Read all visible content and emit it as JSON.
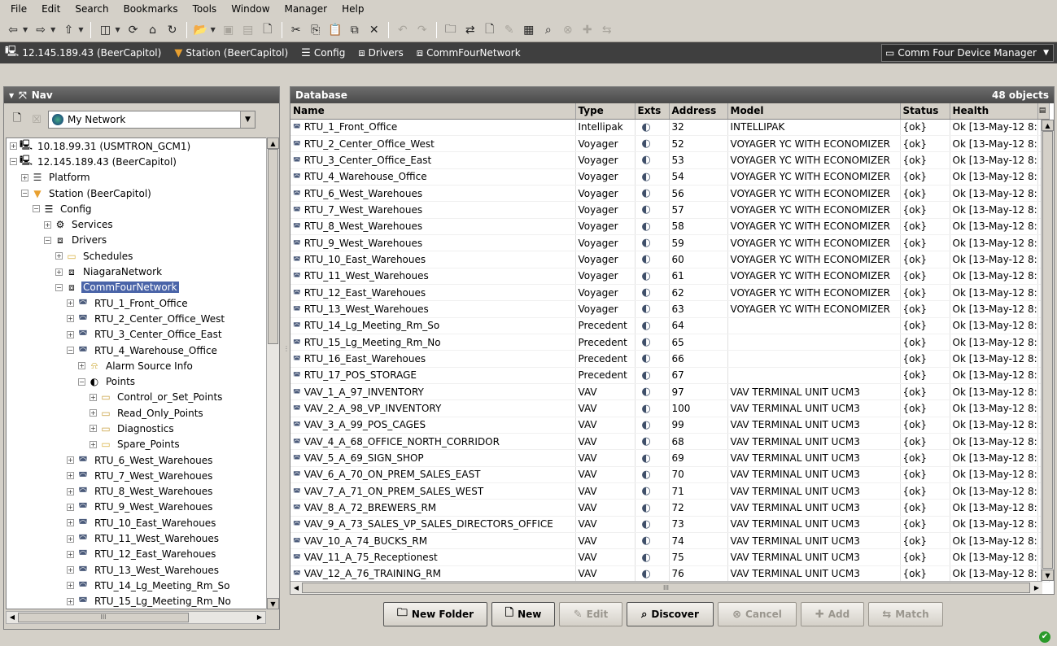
{
  "menu": [
    "File",
    "Edit",
    "Search",
    "Bookmarks",
    "Tools",
    "Window",
    "Manager",
    "Help"
  ],
  "locator": [
    {
      "label": "12.145.189.43 (BeerCapitol)",
      "icon": "host-icon"
    },
    {
      "label": "Station (BeerCapitol)",
      "icon": "station-icon"
    },
    {
      "label": "Config",
      "icon": "config-icon"
    },
    {
      "label": "Drivers",
      "icon": "drivers-icon"
    },
    {
      "label": "CommFourNetwork",
      "icon": "network-icon"
    }
  ],
  "view_selector": "Comm Four Device Manager",
  "nav": {
    "title": "Nav",
    "network_select": "My Network",
    "tree": [
      {
        "indent": 0,
        "expander": "+",
        "icon": "host-icon",
        "label": "10.18.99.31 (USMTRON_GCM1)"
      },
      {
        "indent": 0,
        "expander": "−",
        "icon": "host-icon",
        "label": "12.145.189.43 (BeerCapitol)"
      },
      {
        "indent": 1,
        "expander": "+",
        "icon": "platform-icon",
        "label": "Platform"
      },
      {
        "indent": 1,
        "expander": "−",
        "icon": "station-icon",
        "label": "Station (BeerCapitol)"
      },
      {
        "indent": 2,
        "expander": "−",
        "icon": "config-icon",
        "label": "Config"
      },
      {
        "indent": 3,
        "expander": "+",
        "icon": "services-icon",
        "label": "Services"
      },
      {
        "indent": 3,
        "expander": "−",
        "icon": "drivers-icon",
        "label": "Drivers"
      },
      {
        "indent": 4,
        "expander": "+",
        "icon": "folder-icon",
        "label": "Schedules"
      },
      {
        "indent": 4,
        "expander": "+",
        "icon": "network-icon",
        "label": "NiagaraNetwork"
      },
      {
        "indent": 4,
        "expander": "−",
        "icon": "network-icon",
        "label": "CommFourNetwork",
        "selected": true
      },
      {
        "indent": 5,
        "expander": "+",
        "icon": "device-icon",
        "label": "RTU_1_Front_Office"
      },
      {
        "indent": 5,
        "expander": "+",
        "icon": "device-icon",
        "label": "RTU_2_Center_Office_West"
      },
      {
        "indent": 5,
        "expander": "+",
        "icon": "device-icon",
        "label": "RTU_3_Center_Office_East"
      },
      {
        "indent": 5,
        "expander": "−",
        "icon": "device-icon",
        "label": "RTU_4_Warehouse_Office"
      },
      {
        "indent": 6,
        "expander": "+",
        "icon": "alarm-bell-icon",
        "label": "Alarm Source Info"
      },
      {
        "indent": 6,
        "expander": "−",
        "icon": "points-icon",
        "label": "Points"
      },
      {
        "indent": 7,
        "expander": "+",
        "icon": "points-folder-icon",
        "label": "Control_or_Set_Points"
      },
      {
        "indent": 7,
        "expander": "+",
        "icon": "points-folder-icon",
        "label": "Read_Only_Points"
      },
      {
        "indent": 7,
        "expander": "+",
        "icon": "points-folder-icon",
        "label": "Diagnostics"
      },
      {
        "indent": 7,
        "expander": "+",
        "icon": "folder-icon",
        "label": "Spare_Points"
      },
      {
        "indent": 5,
        "expander": "+",
        "icon": "device-icon",
        "label": "RTU_6_West_Warehoues"
      },
      {
        "indent": 5,
        "expander": "+",
        "icon": "device-icon",
        "label": "RTU_7_West_Warehoues"
      },
      {
        "indent": 5,
        "expander": "+",
        "icon": "device-icon",
        "label": "RTU_8_West_Warehoues"
      },
      {
        "indent": 5,
        "expander": "+",
        "icon": "device-icon",
        "label": "RTU_9_West_Warehoues"
      },
      {
        "indent": 5,
        "expander": "+",
        "icon": "device-icon",
        "label": "RTU_10_East_Warehoues"
      },
      {
        "indent": 5,
        "expander": "+",
        "icon": "device-icon",
        "label": "RTU_11_West_Warehoues"
      },
      {
        "indent": 5,
        "expander": "+",
        "icon": "device-icon",
        "label": "RTU_12_East_Warehoues"
      },
      {
        "indent": 5,
        "expander": "+",
        "icon": "device-icon",
        "label": "RTU_13_West_Warehoues"
      },
      {
        "indent": 5,
        "expander": "+",
        "icon": "device-icon",
        "label": "RTU_14_Lg_Meeting_Rm_So"
      },
      {
        "indent": 5,
        "expander": "+",
        "icon": "device-icon",
        "label": "RTU_15_Lg_Meeting_Rm_No"
      }
    ],
    "hscroll_marker": "III"
  },
  "database": {
    "title": "Database",
    "count": "48 objects",
    "columns": [
      "Name",
      "Type",
      "Exts",
      "Address",
      "Model",
      "Status",
      "Health"
    ],
    "rows": [
      [
        "RTU_1_Front_Office",
        "Intellipak",
        "32",
        "INTELLIPAK",
        "{ok}",
        "Ok [13-May-12 8:"
      ],
      [
        "RTU_2_Center_Office_West",
        "Voyager",
        "52",
        "VOYAGER YC WITH ECONOMIZER",
        "{ok}",
        "Ok [13-May-12 8:"
      ],
      [
        "RTU_3_Center_Office_East",
        "Voyager",
        "53",
        "VOYAGER YC WITH ECONOMIZER",
        "{ok}",
        "Ok [13-May-12 8:"
      ],
      [
        "RTU_4_Warehouse_Office",
        "Voyager",
        "54",
        "VOYAGER YC WITH ECONOMIZER",
        "{ok}",
        "Ok [13-May-12 8:"
      ],
      [
        "RTU_6_West_Warehoues",
        "Voyager",
        "56",
        "VOYAGER YC WITH ECONOMIZER",
        "{ok}",
        "Ok [13-May-12 8:"
      ],
      [
        "RTU_7_West_Warehoues",
        "Voyager",
        "57",
        "VOYAGER YC WITH ECONOMIZER",
        "{ok}",
        "Ok [13-May-12 8:"
      ],
      [
        "RTU_8_West_Warehoues",
        "Voyager",
        "58",
        "VOYAGER YC WITH ECONOMIZER",
        "{ok}",
        "Ok [13-May-12 8:"
      ],
      [
        "RTU_9_West_Warehoues",
        "Voyager",
        "59",
        "VOYAGER YC WITH ECONOMIZER",
        "{ok}",
        "Ok [13-May-12 8:"
      ],
      [
        "RTU_10_East_Warehoues",
        "Voyager",
        "60",
        "VOYAGER YC WITH ECONOMIZER",
        "{ok}",
        "Ok [13-May-12 8:"
      ],
      [
        "RTU_11_West_Warehoues",
        "Voyager",
        "61",
        "VOYAGER YC WITH ECONOMIZER",
        "{ok}",
        "Ok [13-May-12 8:"
      ],
      [
        "RTU_12_East_Warehoues",
        "Voyager",
        "62",
        "VOYAGER YC WITH ECONOMIZER",
        "{ok}",
        "Ok [13-May-12 8:"
      ],
      [
        "RTU_13_West_Warehoues",
        "Voyager",
        "63",
        "VOYAGER YC WITH ECONOMIZER",
        "{ok}",
        "Ok [13-May-12 8:"
      ],
      [
        "RTU_14_Lg_Meeting_Rm_So",
        "Precedent",
        "64",
        "",
        "{ok}",
        "Ok [13-May-12 8:"
      ],
      [
        "RTU_15_Lg_Meeting_Rm_No",
        "Precedent",
        "65",
        "",
        "{ok}",
        "Ok [13-May-12 8:"
      ],
      [
        "RTU_16_East_Warehoues",
        "Precedent",
        "66",
        "",
        "{ok}",
        "Ok [13-May-12 8:"
      ],
      [
        "RTU_17_POS_STORAGE",
        "Precedent",
        "67",
        "",
        "{ok}",
        "Ok [13-May-12 8:"
      ],
      [
        "VAV_1_A_97_INVENTORY",
        "VAV",
        "97",
        "VAV TERMINAL UNIT UCM3",
        "{ok}",
        "Ok [13-May-12 8:"
      ],
      [
        "VAV_2_A_98_VP_INVENTORY",
        "VAV",
        "100",
        "VAV TERMINAL UNIT UCM3",
        "{ok}",
        "Ok [13-May-12 8:"
      ],
      [
        "VAV_3_A_99_POS_CAGES",
        "VAV",
        "99",
        "VAV TERMINAL UNIT UCM3",
        "{ok}",
        "Ok [13-May-12 8:"
      ],
      [
        "VAV_4_A_68_OFFICE_NORTH_CORRIDOR",
        "VAV",
        "68",
        "VAV TERMINAL UNIT UCM3",
        "{ok}",
        "Ok [13-May-12 8:"
      ],
      [
        "VAV_5_A_69_SIGN_SHOP",
        "VAV",
        "69",
        "VAV TERMINAL UNIT UCM3",
        "{ok}",
        "Ok [13-May-12 8:"
      ],
      [
        "VAV_6_A_70_ON_PREM_SALES_EAST",
        "VAV",
        "70",
        "VAV TERMINAL UNIT UCM3",
        "{ok}",
        "Ok [13-May-12 8:"
      ],
      [
        "VAV_7_A_71_ON_PREM_SALES_WEST",
        "VAV",
        "71",
        "VAV TERMINAL UNIT UCM3",
        "{ok}",
        "Ok [13-May-12 8:"
      ],
      [
        "VAV_8_A_72_BREWERS_RM",
        "VAV",
        "72",
        "VAV TERMINAL UNIT UCM3",
        "{ok}",
        "Ok [13-May-12 8:"
      ],
      [
        "VAV_9_A_73_SALES_VP_SALES_DIRECTORS_OFFICE",
        "VAV",
        "73",
        "VAV TERMINAL UNIT UCM3",
        "{ok}",
        "Ok [13-May-12 8:"
      ],
      [
        "VAV_10_A_74_BUCKS_RM",
        "VAV",
        "74",
        "VAV TERMINAL UNIT UCM3",
        "{ok}",
        "Ok [13-May-12 8:"
      ],
      [
        "VAV_11_A_75_Receptionest",
        "VAV",
        "75",
        "VAV TERMINAL UNIT UCM3",
        "{ok}",
        "Ok [13-May-12 8:"
      ],
      [
        "VAV_12_A_76_TRAINING_RM",
        "VAV",
        "76",
        "VAV TERMINAL UNIT UCM3",
        "{ok}",
        "Ok [13-May-12 8:"
      ]
    ],
    "hscroll_marker": "III"
  },
  "buttons": [
    {
      "label": "New Folder",
      "icon": "new-folder-icon",
      "enabled": true
    },
    {
      "label": "New",
      "icon": "new-icon",
      "enabled": true
    },
    {
      "label": "Edit",
      "icon": "edit-icon",
      "enabled": false
    },
    {
      "label": "Discover",
      "icon": "binoculars-icon",
      "enabled": true
    },
    {
      "label": "Cancel",
      "icon": "cancel-icon",
      "enabled": false
    },
    {
      "label": "Add",
      "icon": "add-icon",
      "enabled": false
    },
    {
      "label": "Match",
      "icon": "match-icon",
      "enabled": false
    }
  ],
  "colors": {
    "chrome": "#d4d0c8",
    "locator_bar": "#3f3f3f",
    "selection": "#4a64a8",
    "status_ok": "#2a9a2a"
  }
}
